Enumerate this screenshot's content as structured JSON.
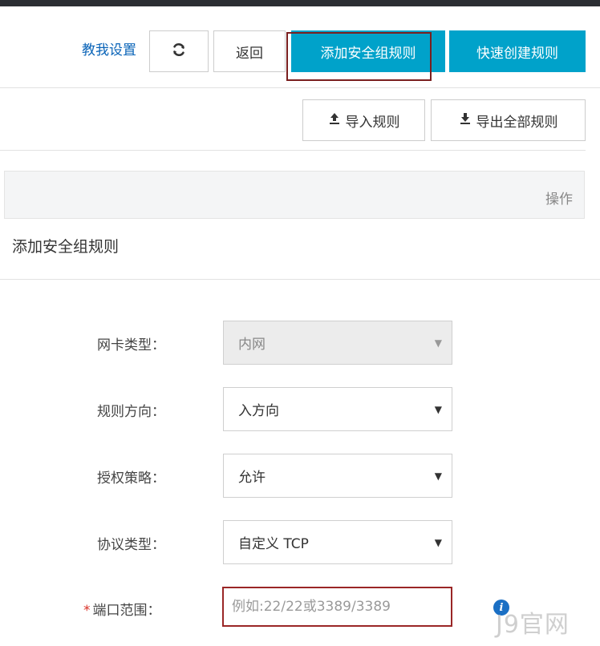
{
  "toolbar": {
    "help_label": "教我设置",
    "refresh_icon": "refresh-icon",
    "back_label": "返回",
    "add_rule_label": "添加安全组规则",
    "quick_create_label": "快速创建规则",
    "import_label": "导入规则",
    "export_label": "导出全部规则",
    "upload_icon": "upload-icon",
    "download_icon": "download-icon"
  },
  "table": {
    "operation_header": "操作"
  },
  "dialog": {
    "title": "添加安全组规则",
    "fields": {
      "nic_type": {
        "label": "网卡类型：",
        "value": "内网",
        "disabled": true
      },
      "direction": {
        "label": "规则方向：",
        "value": "入方向"
      },
      "policy": {
        "label": "授权策略：",
        "value": "允许"
      },
      "protocol": {
        "label": "协议类型：",
        "value": "自定义 TCP"
      },
      "port_range": {
        "required_mark": "*",
        "label": "端口范围：",
        "placeholder": "例如:22/22或3389/3389",
        "value": ""
      }
    },
    "info_icon": "info-icon"
  },
  "watermark": "J9官网",
  "colors": {
    "primary": "#00a2ca",
    "link": "#0a64b8",
    "highlight_border": "#7a1f1f",
    "required": "#d93026",
    "topbar": "#2b2e33"
  }
}
